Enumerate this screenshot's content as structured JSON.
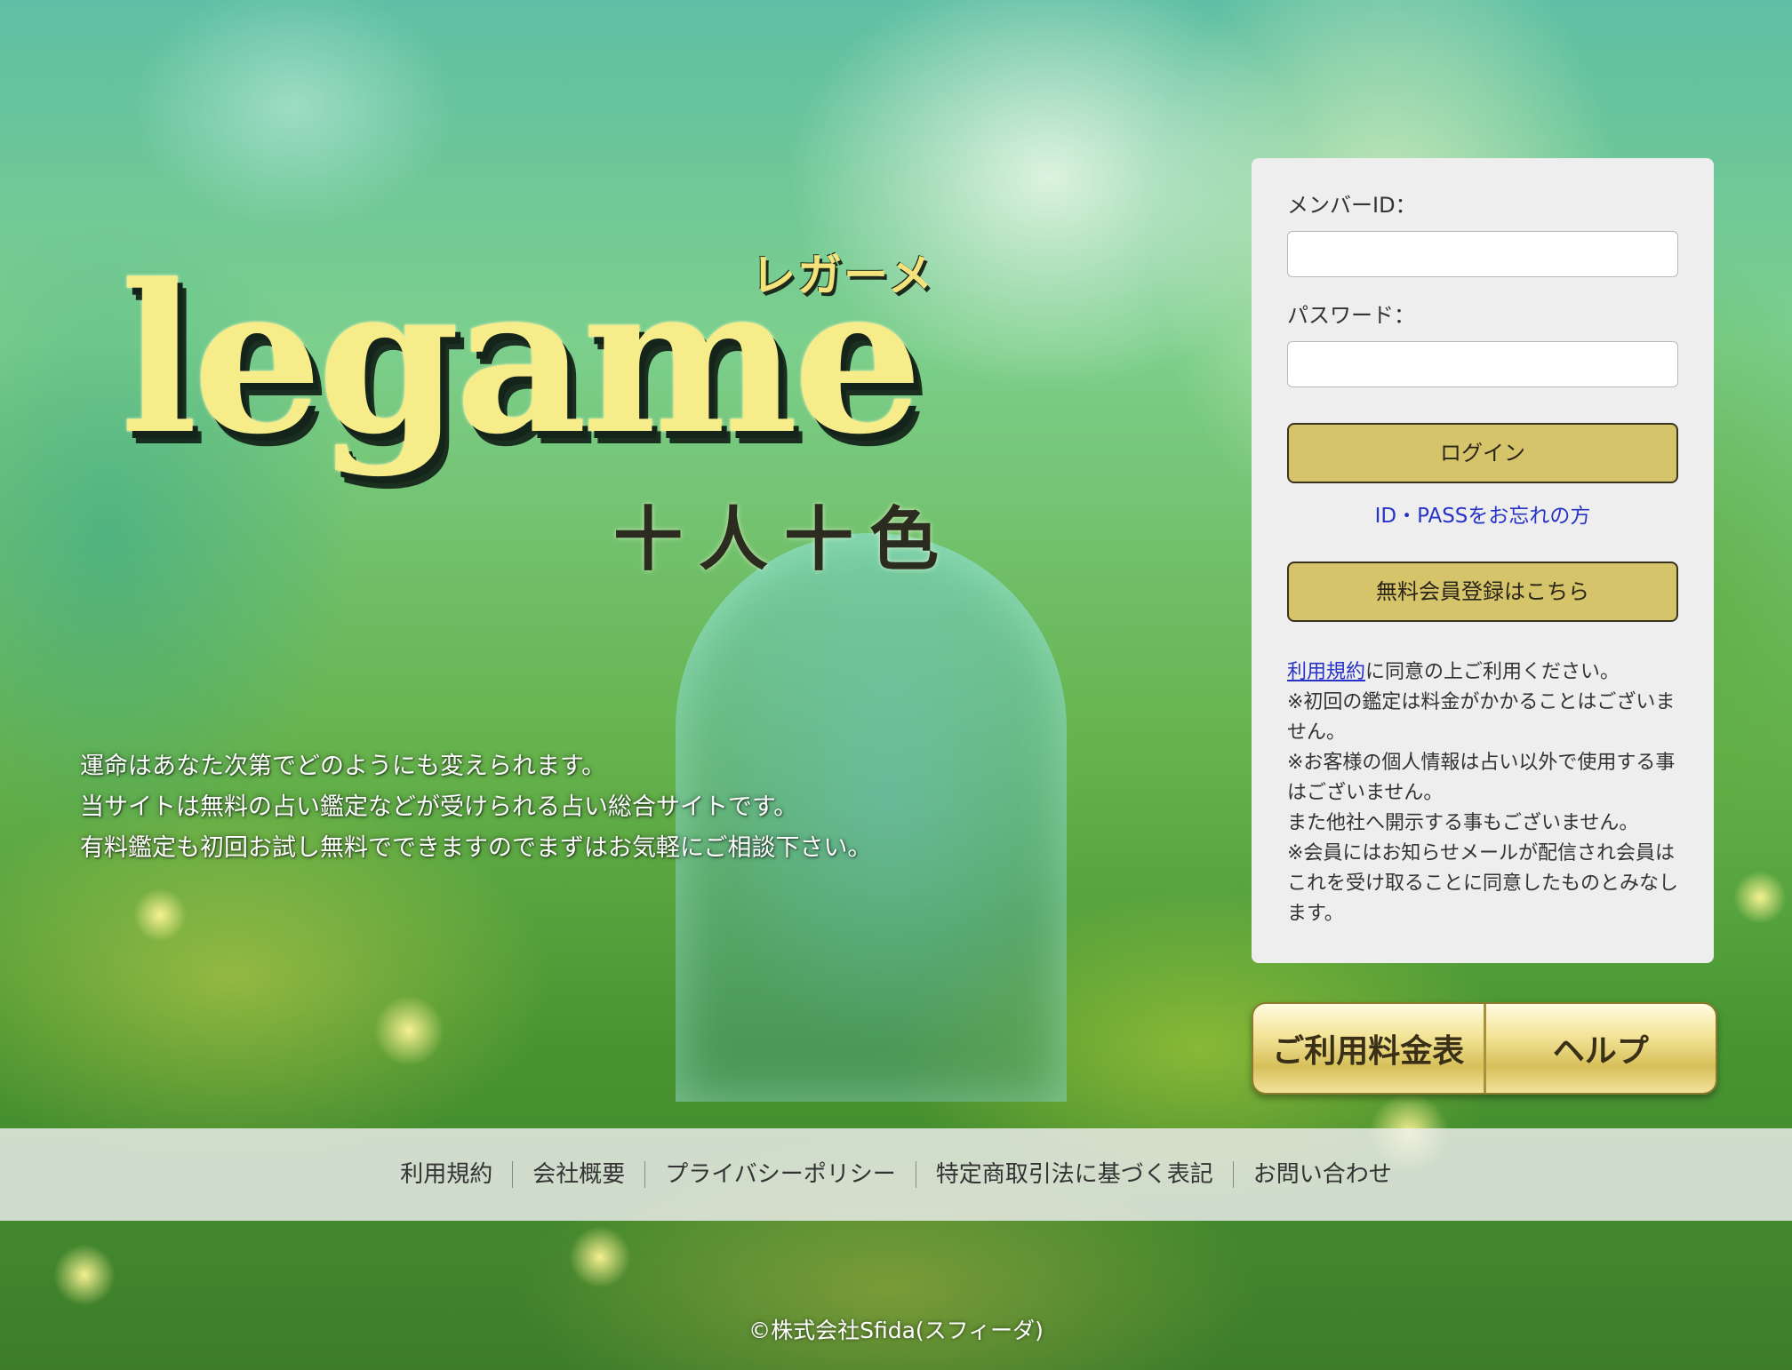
{
  "logo": {
    "main": "legame",
    "katakana": "レガーメ",
    "sub": "十人十色"
  },
  "intro": {
    "lines": [
      "運命はあなた次第でどのようにも変えられます。",
      "当サイトは無料の占い鑑定などが受けられる占い総合サイトです。",
      "有料鑑定も初回お試し無料でできますのでまずはお気軽にご相談下さい。"
    ]
  },
  "login": {
    "member_id_label": "メンバーID：",
    "member_id_value": "",
    "password_label": "パスワード：",
    "password_value": "",
    "login_button": "ログイン",
    "forgot_link": "ID・PASSをお忘れの方",
    "register_button": "無料会員登録はこちら",
    "terms_link": "利用規約",
    "terms_suffix": "に同意の上ご利用ください。",
    "notes": [
      "※初回の鑑定は料金がかかることはございません。",
      "※お客様の個人情報は占い以外で使用する事はございません。",
      "また他社へ開示する事もございません。",
      "※会員にはお知らせメールが配信され会員はこれを受け取ることに同意したものとみなします。"
    ]
  },
  "side_buttons": {
    "price_table": "ご利用料金表",
    "help": "ヘルプ"
  },
  "footer": {
    "links": [
      "利用規約",
      "会社概要",
      "プライバシーポリシー",
      "特定商取引法に基づく表記",
      "お問い合わせ"
    ],
    "copyright": "©株式会社Sfida(スフィーダ)"
  },
  "colors": {
    "gold_button": "#d6c46a",
    "link_blue": "#2733c7",
    "panel_bg": "#eeeeee"
  }
}
